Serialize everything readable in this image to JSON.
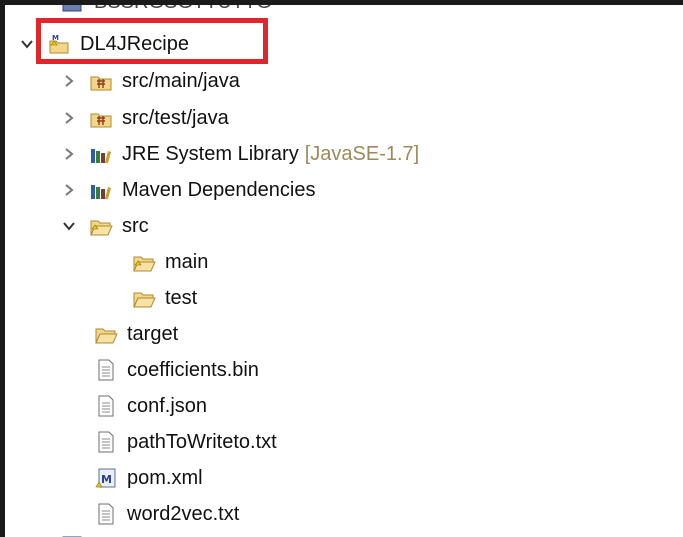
{
  "explorer": {
    "partial_top_label": "BSSRGSGTTUTTG",
    "project": {
      "label": "DL4JRecipe"
    },
    "items": [
      {
        "label": "src/main/java"
      },
      {
        "label": "src/test/java"
      },
      {
        "label": "JRE System Library",
        "decoration": "[JavaSE-1.7]"
      },
      {
        "label": "Maven Dependencies"
      },
      {
        "label": "src"
      },
      {
        "label": "main"
      },
      {
        "label": "test"
      },
      {
        "label": "target"
      },
      {
        "label": "coefficients.bin"
      },
      {
        "label": "conf.json"
      },
      {
        "label": "pathToWriteto.txt"
      },
      {
        "label": "pom.xml"
      },
      {
        "label": "word2vec.txt"
      }
    ]
  },
  "colors": {
    "highlight_border": "#e0262b",
    "decoration_text": "#9c8a5a",
    "folder_fill": "#f3d68a",
    "folder_stroke": "#b08a2c"
  }
}
